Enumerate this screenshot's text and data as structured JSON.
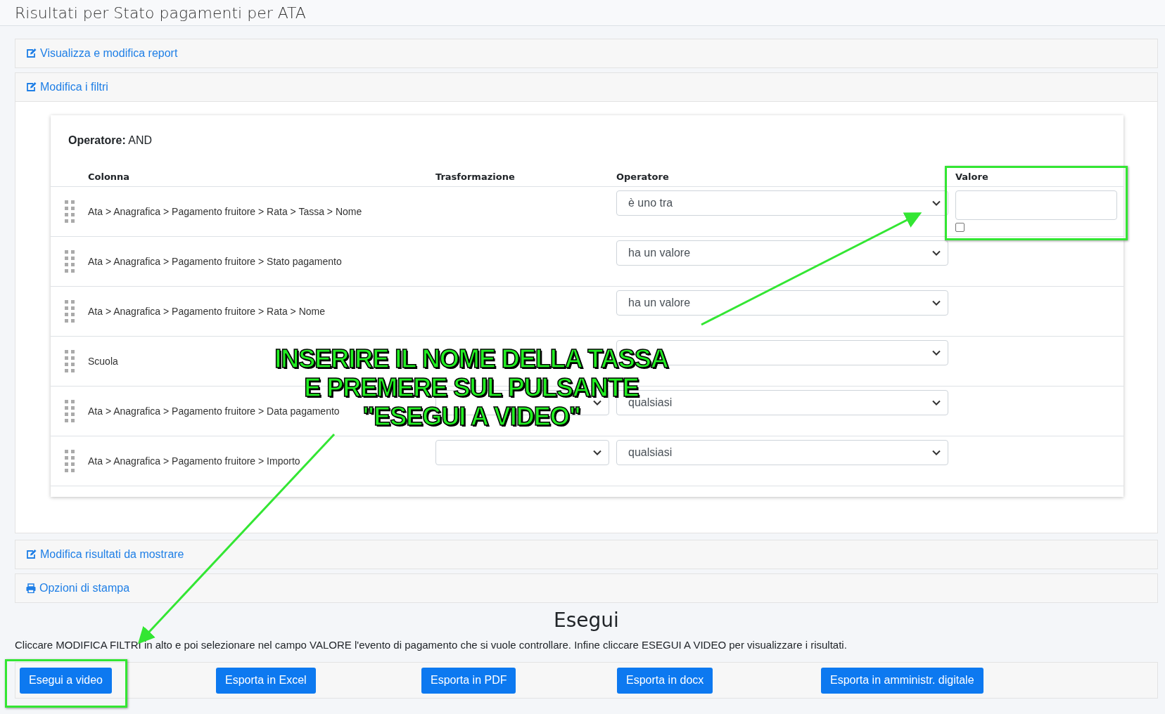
{
  "page_title": "Risultati per Stato pagamenti per ATA",
  "panels_top": [
    {
      "label": "Visualizza e modifica report",
      "kind": "edit"
    },
    {
      "label": "Modifica i filtri",
      "kind": "edit"
    }
  ],
  "filters": {
    "operator_label": "Operatore:",
    "operator_value": "AND",
    "columns": [
      "Colonna",
      "Trasformazione",
      "Operatore",
      "Valore"
    ],
    "rows": [
      {
        "column": "Ata > Anagrafica > Pagamento fruitore > Rata > Tassa > Nome",
        "transform_select": false,
        "operator": "è uno tra",
        "value_field": true,
        "value_checked": false
      },
      {
        "column": "Ata > Anagrafica > Pagamento fruitore > Stato pagamento",
        "transform_select": false,
        "operator": "ha un valore",
        "value_field": false
      },
      {
        "column": "Ata > Anagrafica > Pagamento fruitore > Rata > Nome",
        "transform_select": false,
        "operator": "ha un valore",
        "value_field": false
      },
      {
        "column": "Scuola",
        "transform_select": false,
        "value_field": false
      },
      {
        "column": "Ata > Anagrafica > Pagamento fruitore > Data pagamento",
        "transform_select": true,
        "operator": "qualsiasi",
        "value_field": false
      },
      {
        "column": "Ata > Anagrafica > Pagamento fruitore > Importo",
        "transform_select": true,
        "operator": "qualsiasi",
        "value_field": false
      }
    ]
  },
  "panels_bottom": [
    {
      "label": "Modifica risultati da mostrare",
      "kind": "edit"
    },
    {
      "label": "Opzioni di stampa",
      "kind": "print"
    }
  ],
  "run": {
    "heading": "Esegui",
    "instructions": "Cliccare MODIFICA FILTRI in alto e poi selezionare nel campo VALORE l'evento di pagamento che si vuole controllare. Infine cliccare ESEGUI A VIDEO per visualizzare i risultati.",
    "buttons": [
      "Esegui a video",
      "Esporta in Excel",
      "Esporta in PDF",
      "Esporta in docx",
      "Esporta in amministr. digitale"
    ]
  },
  "annotation": {
    "lines": [
      "INSERIRE IL NOME DELLA TASSA",
      "E PREMERE SUL PULSANTE",
      "\"ESEGUI A VIDEO\""
    ]
  }
}
